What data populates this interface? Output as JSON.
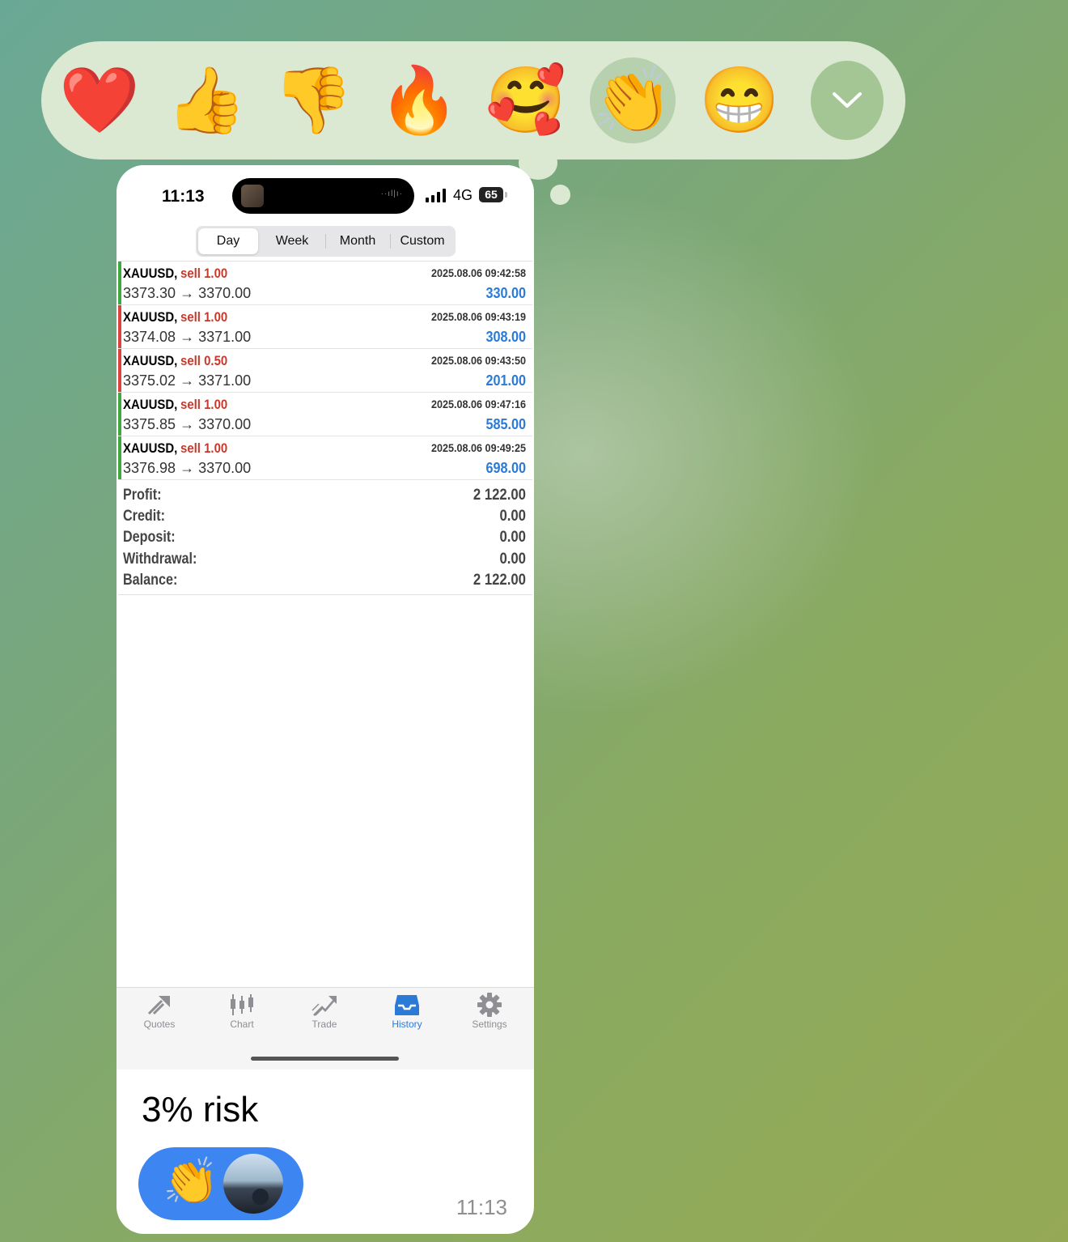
{
  "reactions": {
    "items": [
      "❤️",
      "👍",
      "👎",
      "🔥",
      "🥰",
      "👏",
      "😁"
    ],
    "selected": "👏"
  },
  "status_bar": {
    "time": "11:13",
    "network": "4G",
    "battery": "65"
  },
  "segments": [
    "Day",
    "Week",
    "Month",
    "Custom"
  ],
  "active_segment": "Day",
  "trades": [
    {
      "symbol": "XAUUSD,",
      "side": "sell 1.00",
      "open": "3373.30",
      "close": "3370.00",
      "time": "2025.08.06 09:42:58",
      "profit": "330.00",
      "bar": "#3caa3c"
    },
    {
      "symbol": "XAUUSD,",
      "side": "sell 1.00",
      "open": "3374.08",
      "close": "3371.00",
      "time": "2025.08.06 09:43:19",
      "profit": "308.00",
      "bar": "#d9453a"
    },
    {
      "symbol": "XAUUSD,",
      "side": "sell 0.50",
      "open": "3375.02",
      "close": "3371.00",
      "time": "2025.08.06 09:43:50",
      "profit": "201.00",
      "bar": "#d9453a"
    },
    {
      "symbol": "XAUUSD,",
      "side": "sell 1.00",
      "open": "3375.85",
      "close": "3370.00",
      "time": "2025.08.06 09:47:16",
      "profit": "585.00",
      "bar": "#3caa3c"
    },
    {
      "symbol": "XAUUSD,",
      "side": "sell 1.00",
      "open": "3376.98",
      "close": "3370.00",
      "time": "2025.08.06 09:49:25",
      "profit": "698.00",
      "bar": "#3caa3c"
    }
  ],
  "arrow": "→",
  "summary": [
    {
      "label": "Profit:",
      "value": "2 122.00"
    },
    {
      "label": "Credit:",
      "value": "0.00"
    },
    {
      "label": "Deposit:",
      "value": "0.00"
    },
    {
      "label": "Withdrawal:",
      "value": "0.00"
    },
    {
      "label": "Balance:",
      "value": "2 122.00"
    }
  ],
  "tabs": [
    {
      "label": "Quotes",
      "icon": "quotes-icon"
    },
    {
      "label": "Chart",
      "icon": "chart-icon"
    },
    {
      "label": "Trade",
      "icon": "trade-icon"
    },
    {
      "label": "History",
      "icon": "history-icon"
    },
    {
      "label": "Settings",
      "icon": "settings-icon"
    }
  ],
  "active_tab": "History",
  "message": {
    "text": "3% risk",
    "time": "11:13",
    "reaction": "👏"
  },
  "colors": {
    "accent": "#2b7bd6",
    "sell": "#c8392b",
    "chip": "#3d85f0"
  }
}
